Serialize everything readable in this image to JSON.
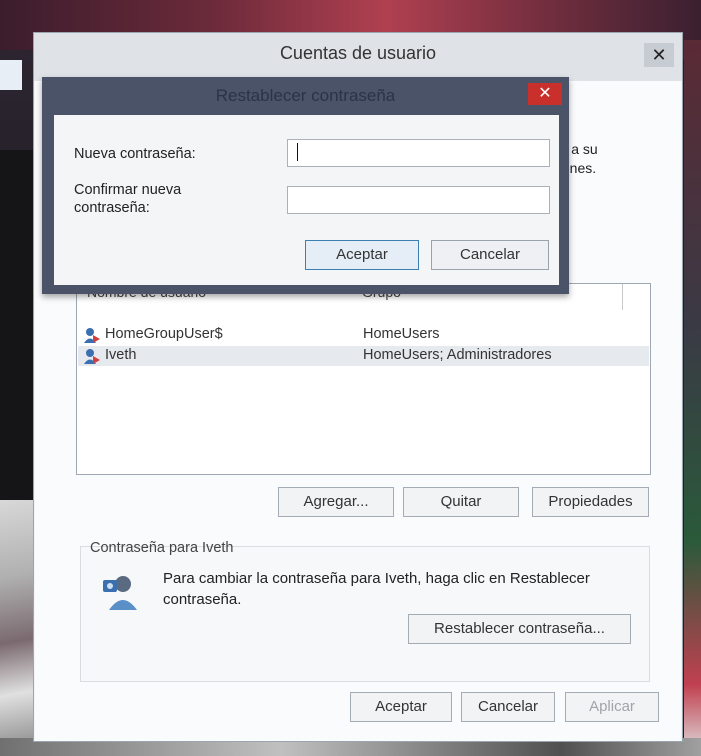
{
  "outer_window": {
    "title": "Cuentas de usuario",
    "close_glyph": "✕",
    "info_text_line1": "ario a su",
    "info_text_line2": "aciones.",
    "table": {
      "col_user": "Nombre de usuario",
      "col_group": "Grupo",
      "rows": [
        {
          "name": "HomeGroupUser$",
          "group": "HomeUsers",
          "selected": false
        },
        {
          "name": "Iveth",
          "group": "HomeUsers; Administradores",
          "selected": true
        }
      ]
    },
    "buttons": {
      "add": "Agregar...",
      "remove": "Quitar",
      "properties": "Propiedades"
    },
    "password_section": {
      "label": "Contraseña para Iveth",
      "desc_line1": "Para cambiar la contraseña para Iveth, haga clic en Restablecer",
      "desc_line2": "contraseña.",
      "reset_button": "Restablecer contraseña..."
    },
    "footer": {
      "ok": "Aceptar",
      "cancel": "Cancelar",
      "apply": "Aplicar"
    }
  },
  "reset_dialog": {
    "title": "Restablecer contraseña",
    "close_glyph": "✕",
    "new_password_label": "Nueva contraseña:",
    "new_password_value": "",
    "confirm_label_line1": "Confirmar nueva",
    "confirm_label_line2": "contraseña:",
    "confirm_value": "",
    "ok": "Aceptar",
    "cancel": "Cancelar"
  },
  "colors": {
    "close_red": "#c9302c",
    "dialog_frame": "#4a5368",
    "selection": "#e6e9ee"
  },
  "icons": {
    "user": "user-icon",
    "key_user": "user-key-icon",
    "close": "close-icon"
  }
}
